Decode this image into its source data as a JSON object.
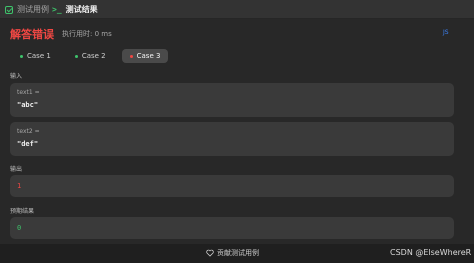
{
  "tabs": [
    {
      "label": "测试用例",
      "icon": "check-square-icon"
    },
    {
      "label": "测试结果",
      "icon": "terminal-prompt-icon"
    }
  ],
  "result": {
    "title": "解答错误",
    "runtime": "执行用时: 0 ms",
    "lang_link": "JS"
  },
  "cases": [
    {
      "label": "Case 1",
      "status": "passed"
    },
    {
      "label": "Case 2",
      "status": "passed"
    },
    {
      "label": "Case 3",
      "status": "failed"
    }
  ],
  "input": {
    "label": "输入",
    "params": [
      {
        "name": "text1 =",
        "value": "\"abc\""
      },
      {
        "name": "text2 =",
        "value": "\"def\""
      }
    ]
  },
  "output": {
    "label": "输出",
    "value": "1"
  },
  "expected": {
    "label": "预期结果",
    "value": "0"
  },
  "footer": {
    "contribute": "贡献测试用例",
    "watermark": "CSDN @ElseWhereR"
  },
  "colors": {
    "error": "#ef4743",
    "success": "#3ec36b",
    "link": "#3b82f6"
  }
}
